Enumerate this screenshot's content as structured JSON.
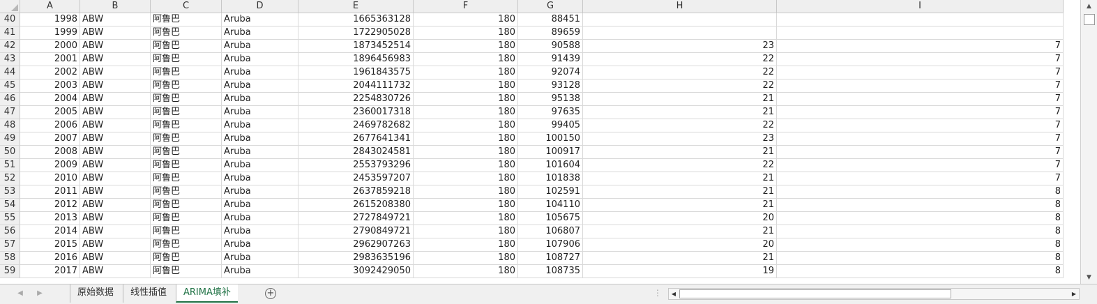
{
  "columns": [
    "A",
    "B",
    "C",
    "D",
    "E",
    "F",
    "G",
    "H",
    "I"
  ],
  "rows": [
    {
      "row": "40",
      "A": "1998",
      "B": "ABW",
      "C": "阿鲁巴",
      "D": "Aruba",
      "E": "1665363128",
      "F": "180",
      "G": "88451",
      "H": "",
      "I": ""
    },
    {
      "row": "41",
      "A": "1999",
      "B": "ABW",
      "C": "阿鲁巴",
      "D": "Aruba",
      "E": "1722905028",
      "F": "180",
      "G": "89659",
      "H": "",
      "I": ""
    },
    {
      "row": "42",
      "A": "2000",
      "B": "ABW",
      "C": "阿鲁巴",
      "D": "Aruba",
      "E": "1873452514",
      "F": "180",
      "G": "90588",
      "H": "23",
      "I": "7"
    },
    {
      "row": "43",
      "A": "2001",
      "B": "ABW",
      "C": "阿鲁巴",
      "D": "Aruba",
      "E": "1896456983",
      "F": "180",
      "G": "91439",
      "H": "22",
      "I": "7"
    },
    {
      "row": "44",
      "A": "2002",
      "B": "ABW",
      "C": "阿鲁巴",
      "D": "Aruba",
      "E": "1961843575",
      "F": "180",
      "G": "92074",
      "H": "22",
      "I": "7"
    },
    {
      "row": "45",
      "A": "2003",
      "B": "ABW",
      "C": "阿鲁巴",
      "D": "Aruba",
      "E": "2044111732",
      "F": "180",
      "G": "93128",
      "H": "22",
      "I": "7"
    },
    {
      "row": "46",
      "A": "2004",
      "B": "ABW",
      "C": "阿鲁巴",
      "D": "Aruba",
      "E": "2254830726",
      "F": "180",
      "G": "95138",
      "H": "21",
      "I": "7"
    },
    {
      "row": "47",
      "A": "2005",
      "B": "ABW",
      "C": "阿鲁巴",
      "D": "Aruba",
      "E": "2360017318",
      "F": "180",
      "G": "97635",
      "H": "21",
      "I": "7"
    },
    {
      "row": "48",
      "A": "2006",
      "B": "ABW",
      "C": "阿鲁巴",
      "D": "Aruba",
      "E": "2469782682",
      "F": "180",
      "G": "99405",
      "H": "22",
      "I": "7"
    },
    {
      "row": "49",
      "A": "2007",
      "B": "ABW",
      "C": "阿鲁巴",
      "D": "Aruba",
      "E": "2677641341",
      "F": "180",
      "G": "100150",
      "H": "23",
      "I": "7"
    },
    {
      "row": "50",
      "A": "2008",
      "B": "ABW",
      "C": "阿鲁巴",
      "D": "Aruba",
      "E": "2843024581",
      "F": "180",
      "G": "100917",
      "H": "21",
      "I": "7"
    },
    {
      "row": "51",
      "A": "2009",
      "B": "ABW",
      "C": "阿鲁巴",
      "D": "Aruba",
      "E": "2553793296",
      "F": "180",
      "G": "101604",
      "H": "22",
      "I": "7"
    },
    {
      "row": "52",
      "A": "2010",
      "B": "ABW",
      "C": "阿鲁巴",
      "D": "Aruba",
      "E": "2453597207",
      "F": "180",
      "G": "101838",
      "H": "21",
      "I": "7"
    },
    {
      "row": "53",
      "A": "2011",
      "B": "ABW",
      "C": "阿鲁巴",
      "D": "Aruba",
      "E": "2637859218",
      "F": "180",
      "G": "102591",
      "H": "21",
      "I": "8"
    },
    {
      "row": "54",
      "A": "2012",
      "B": "ABW",
      "C": "阿鲁巴",
      "D": "Aruba",
      "E": "2615208380",
      "F": "180",
      "G": "104110",
      "H": "21",
      "I": "8"
    },
    {
      "row": "55",
      "A": "2013",
      "B": "ABW",
      "C": "阿鲁巴",
      "D": "Aruba",
      "E": "2727849721",
      "F": "180",
      "G": "105675",
      "H": "20",
      "I": "8"
    },
    {
      "row": "56",
      "A": "2014",
      "B": "ABW",
      "C": "阿鲁巴",
      "D": "Aruba",
      "E": "2790849721",
      "F": "180",
      "G": "106807",
      "H": "21",
      "I": "8"
    },
    {
      "row": "57",
      "A": "2015",
      "B": "ABW",
      "C": "阿鲁巴",
      "D": "Aruba",
      "E": "2962907263",
      "F": "180",
      "G": "107906",
      "H": "20",
      "I": "8"
    },
    {
      "row": "58",
      "A": "2016",
      "B": "ABW",
      "C": "阿鲁巴",
      "D": "Aruba",
      "E": "2983635196",
      "F": "180",
      "G": "108727",
      "H": "21",
      "I": "8"
    },
    {
      "row": "59",
      "A": "2017",
      "B": "ABW",
      "C": "阿鲁巴",
      "D": "Aruba",
      "E": "3092429050",
      "F": "180",
      "G": "108735",
      "H": "19",
      "I": "8"
    }
  ],
  "sheet_tabs": [
    {
      "label": "原始数据",
      "active": false
    },
    {
      "label": "线性插值",
      "active": false
    },
    {
      "label": "ARIMA填补",
      "active": true
    }
  ]
}
